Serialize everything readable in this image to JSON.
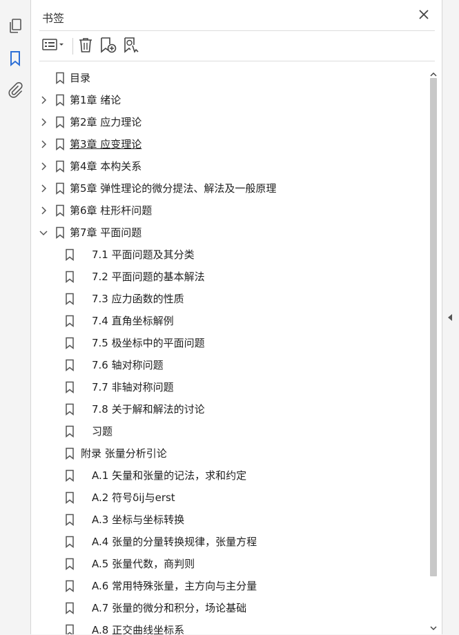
{
  "panel": {
    "title": "书签"
  },
  "rail": {
    "icons": [
      "pages-icon",
      "bookmark-icon",
      "attachment-icon"
    ],
    "accent": "#2c6fd6"
  },
  "toolbar": {
    "icons": [
      "options-menu-icon",
      "delete-icon",
      "new-bookmark-icon",
      "find-bookmark-icon"
    ]
  },
  "bookmarks": [
    {
      "label": "目录",
      "level": 0,
      "expander": "none"
    },
    {
      "label": "第1章  绪论",
      "level": 0,
      "expander": "collapsed"
    },
    {
      "label": "第2章    应力理论",
      "level": 0,
      "expander": "collapsed"
    },
    {
      "label": "第3章    应变理论",
      "level": 0,
      "expander": "collapsed",
      "underline": true
    },
    {
      "label": "第4章    本构关系",
      "level": 0,
      "expander": "collapsed"
    },
    {
      "label": "第5章    弹性理论的微分提法、解法及一般原理",
      "level": 0,
      "expander": "collapsed"
    },
    {
      "label": "第6章    柱形杆问题",
      "level": 0,
      "expander": "collapsed"
    },
    {
      "label": "第7章  平面问题",
      "level": 0,
      "expander": "expanded"
    },
    {
      "label": "7.1    平面问题及其分类",
      "level": 1,
      "expander": "none"
    },
    {
      "label": "7.2    平面问题的基本解法",
      "level": 1,
      "expander": "none"
    },
    {
      "label": "7.3    应力函数的性质",
      "level": 1,
      "expander": "none"
    },
    {
      "label": "7.4    直角坐标解例",
      "level": 1,
      "expander": "none"
    },
    {
      "label": "7.5    极坐标中的平面问题",
      "level": 1,
      "expander": "none"
    },
    {
      "label": "7.6    轴对称问题",
      "level": 1,
      "expander": "none"
    },
    {
      "label": "7.7    非轴对称问题",
      "level": 1,
      "expander": "none"
    },
    {
      "label": "7.8    关于解和解法的讨论",
      "level": 1,
      "expander": "none"
    },
    {
      "label": "习题",
      "level": 1,
      "expander": "none"
    },
    {
      "label": "附录  张量分析引论",
      "level": 0.5,
      "expander": "none"
    },
    {
      "label": "A.1  矢量和张量的记法，求和约定",
      "level": 1,
      "expander": "none"
    },
    {
      "label": "A.2    符号δij与erst",
      "level": 1,
      "expander": "none"
    },
    {
      "label": "A.3    坐标与坐标转换",
      "level": 1,
      "expander": "none"
    },
    {
      "label": "A.4    张量的分量转换规律，张量方程",
      "level": 1,
      "expander": "none"
    },
    {
      "label": "A.5    张量代数，商判则",
      "level": 1,
      "expander": "none"
    },
    {
      "label": "A.6    常用特殊张量，主方向与主分量",
      "level": 1,
      "expander": "none"
    },
    {
      "label": "A.7    张量的微分和积分，场论基础",
      "level": 1,
      "expander": "none"
    },
    {
      "label": "A.8    正交曲线坐标系",
      "level": 1,
      "expander": "none"
    }
  ],
  "scroll": {
    "position": 0,
    "visible_fraction": 0.91
  }
}
